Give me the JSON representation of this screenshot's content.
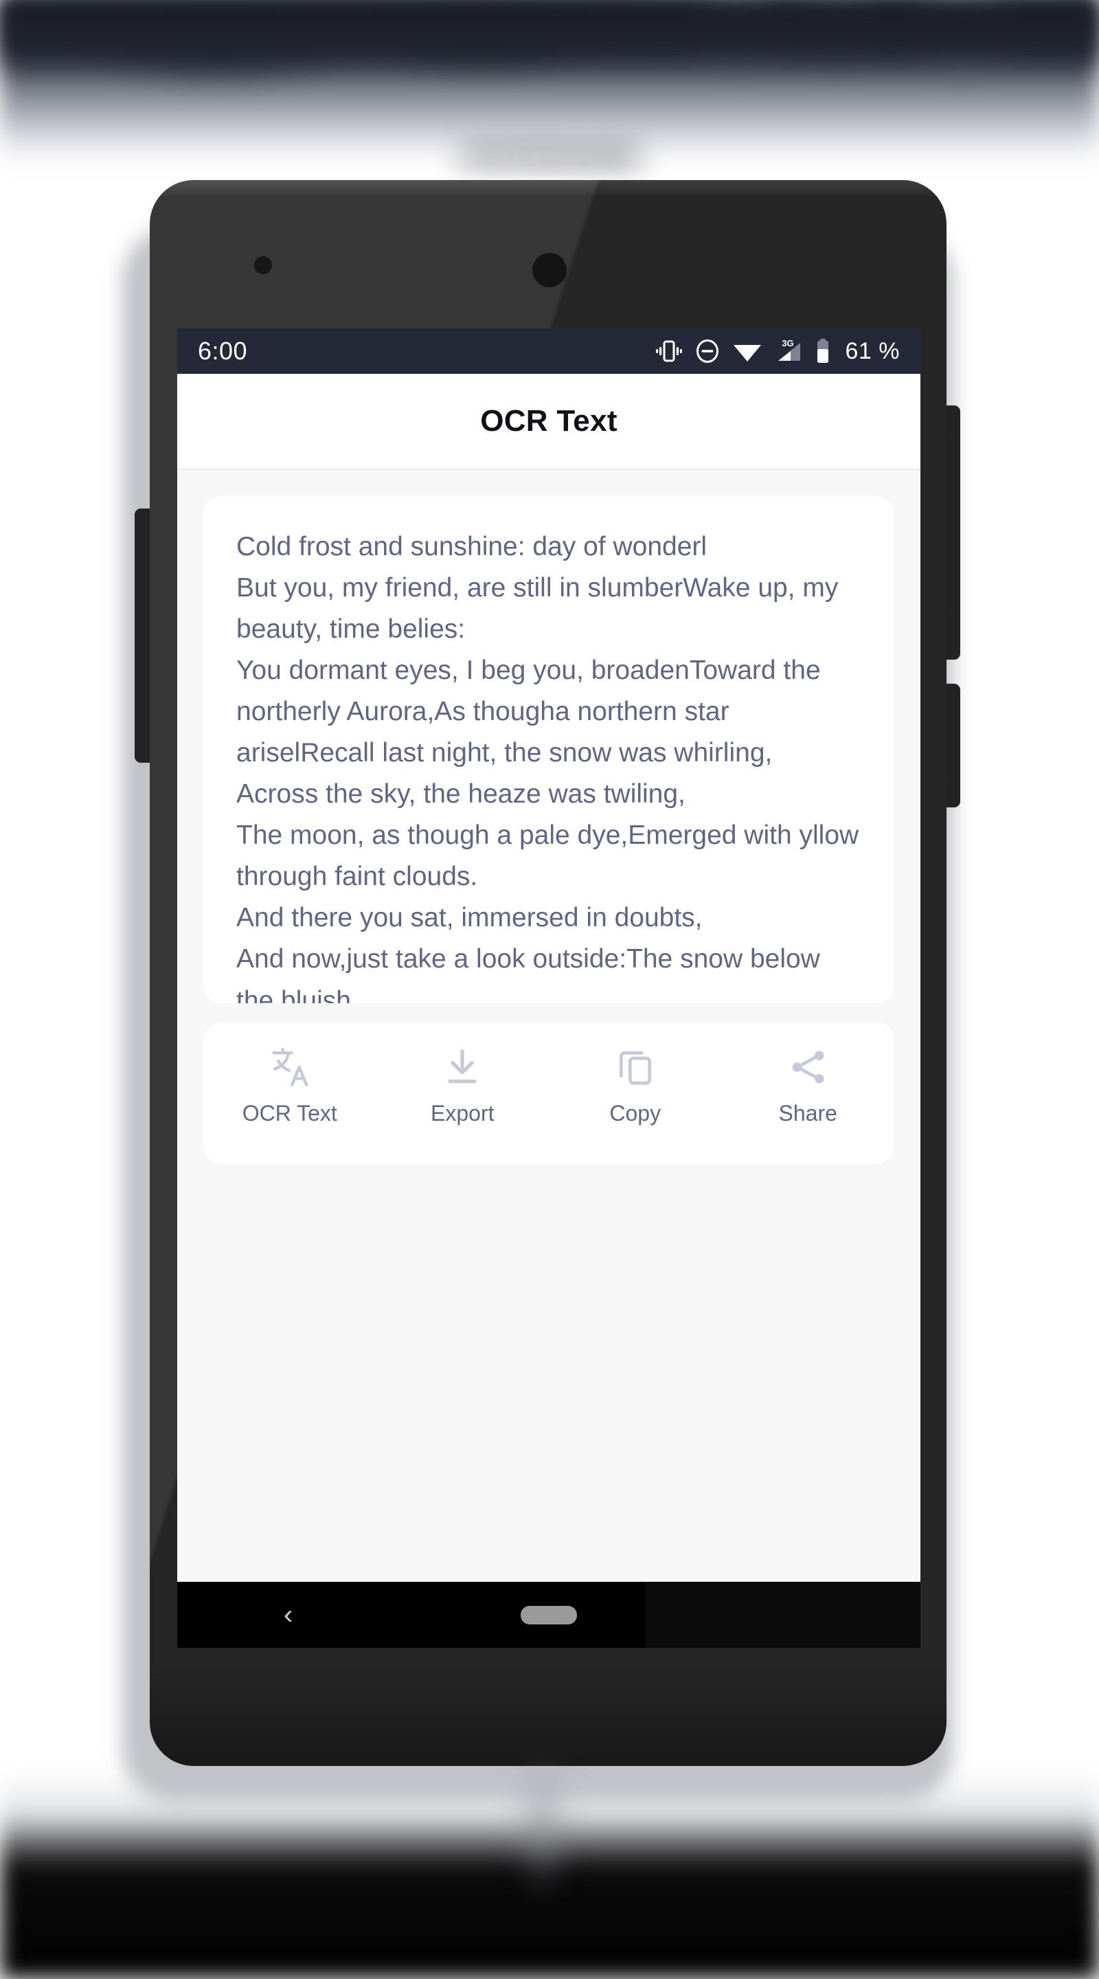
{
  "status_bar": {
    "time": "6:00",
    "battery_percent": "61 %",
    "icons": [
      "vibrate-icon",
      "do-not-disturb-icon",
      "wifi-icon",
      "signal-3g-icon",
      "battery-icon"
    ],
    "network_label": "3G",
    "background_color": "#252836"
  },
  "app_bar": {
    "title": "OCR Text"
  },
  "ocr_card": {
    "text": "Cold frost and sunshine: day of wonderl\nBut you, my friend, are still in slumberWake up, my beauty, time belies:\nYou dormant eyes, I beg you, broadenToward the northerly Aurora,As thougha northern star ariselRecall last night, the snow was whirling,\nAcross the sky, the heaze was twiling,\nThe moon, as though a pale dye,Emerged with yllow through faint clouds.\nAnd there you sat, immersed in doubts,\nAnd now,just take a look outside:The snow below the bluish",
    "text_color": "#5f6586",
    "background_color": "#ffffff"
  },
  "toolbar": {
    "buttons": [
      {
        "label": "OCR Text",
        "icon": "translate-icon"
      },
      {
        "label": "Export",
        "icon": "download-icon"
      },
      {
        "label": "Copy",
        "icon": "copy-icon"
      },
      {
        "label": "Share",
        "icon": "share-icon"
      }
    ],
    "icon_color": "#c6c9d8",
    "label_color": "#5f6586"
  },
  "nav_bar": {
    "back_glyph": "‹",
    "home_pill": "",
    "background_color": "#000000"
  }
}
